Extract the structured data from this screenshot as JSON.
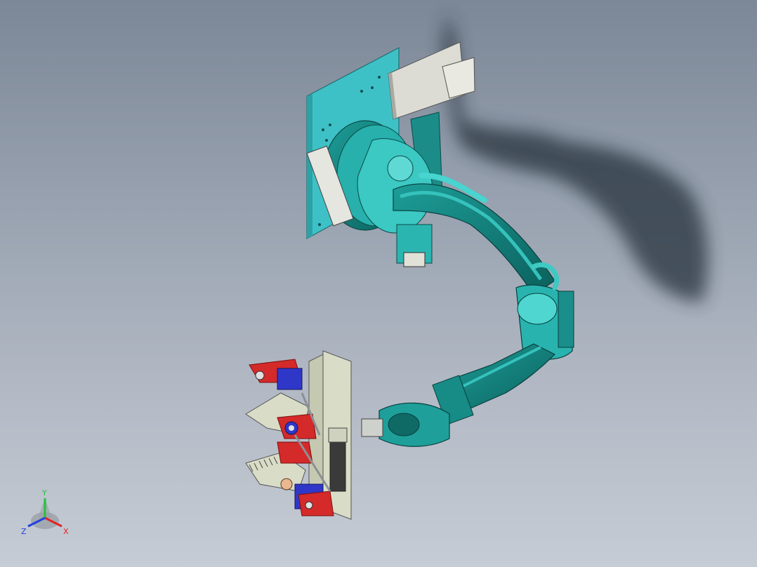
{
  "viewport": {
    "background_top": "#7c8797",
    "background_bottom": "#c6ccd5"
  },
  "model": {
    "accent_teal": "#26b8b8",
    "mount_plate": "#3ec1c6",
    "bracket_grey": "#d7d7cf",
    "gripper_red": "#d42a2a",
    "gripper_blue": "#2f37c8",
    "gripper_beige": "#d9dcc6"
  },
  "triad": {
    "y_label": "Y",
    "z_label": "Z",
    "x_label": "X",
    "y_color": "#22c43a",
    "x_color": "#e02424",
    "z_color": "#2040e0"
  }
}
